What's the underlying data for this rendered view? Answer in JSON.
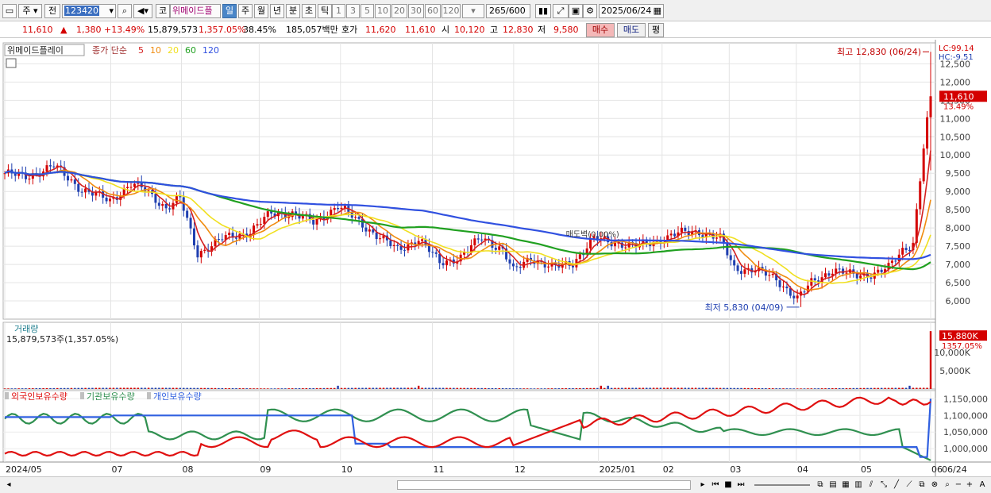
{
  "toolbar": {
    "market": "주",
    "prev": "전",
    "code": "123420",
    "type": "코",
    "name": "위메이드플",
    "periods": [
      "일",
      "주",
      "월",
      "년",
      "분",
      "초",
      "틱"
    ],
    "active_period": "일",
    "intervals": [
      "1",
      "3",
      "5",
      "10",
      "20",
      "30",
      "60",
      "120"
    ],
    "count": "265",
    "count_max": "/600",
    "date": "2025/06/24"
  },
  "quote": {
    "price": "11,610",
    "change": "1,380",
    "change_pct": "+13.49%",
    "volume": "15,879,573",
    "volume_pct": "1,357.05%",
    "turnover": "38.45%",
    "amount": "185,057백만",
    "ask_label": "호가",
    "ask": "11,620",
    "bid": "11,610",
    "open_label": "시",
    "open": "10,120",
    "high_label": "고",
    "high": "12,830",
    "low_label": "저",
    "low": "9,580",
    "buy": "매수",
    "sell": "매도",
    "eval": "평"
  },
  "price_pane": {
    "stock_label": "위메이드플레이",
    "ma_label": "종가 단순",
    "ma_periods": [
      "5",
      "10",
      "20",
      "60",
      "120"
    ],
    "lc": "LC:99.14",
    "hc": "HC:-9.51",
    "high_note": "최고 12,830 (06/24)",
    "low_note": "최저 5,830 (04/09)",
    "last_price": "11,610",
    "last_pct": "13.49%",
    "mid_label": "매도벽(0.00%)",
    "yticks": [
      "12,500",
      "12,000",
      "11,500",
      "11,000",
      "10,500",
      "10,000",
      "9,500",
      "9,000",
      "8,500",
      "8,000",
      "7,500",
      "7,000",
      "6,500",
      "6,000"
    ]
  },
  "volume_pane": {
    "title": "거래량",
    "value": "15,879,573주(1,357.05%)",
    "last": "15,880K",
    "last_pct": "1357.05%",
    "yticks": [
      "10,000K",
      "5,000K"
    ]
  },
  "holdings_pane": {
    "legend": [
      "외국인보유수량",
      "기관보유수량",
      "개인보유수량"
    ],
    "yticks": [
      "1,150,000",
      "1,100,000",
      "1,050,000",
      "1,000,000"
    ]
  },
  "xaxis": {
    "labels": [
      "2024/05",
      "07",
      "08",
      "09",
      "10",
      "11",
      "12",
      "2025/01",
      "02",
      "03",
      "04",
      "05",
      "06"
    ],
    "end_label": "06/24"
  },
  "colors": {
    "candle_up": "#d40000",
    "candle_down": "#1f3fb0",
    "ma5": "#d42020",
    "ma10": "#f08c10",
    "ma20": "#f0e020",
    "ma60": "#20a020",
    "ma120": "#3050e0",
    "foreign": "#e01010",
    "inst": "#309050",
    "retail": "#3060e0"
  }
}
